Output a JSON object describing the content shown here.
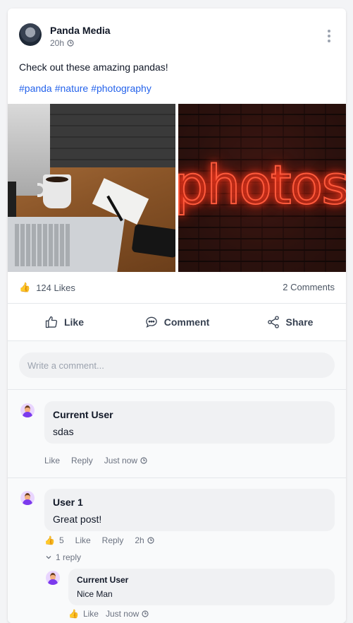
{
  "post": {
    "author": "Panda Media",
    "time": "20h",
    "text": "Check out these amazing pandas!",
    "hashtags": [
      "#panda",
      "#nature",
      "#photography"
    ],
    "photo_neon_text": "photos",
    "likes_emoji": "👍",
    "likes": "124 Likes",
    "comments_count": "2 Comments"
  },
  "actions": {
    "like": "Like",
    "comment": "Comment",
    "share": "Share"
  },
  "comment_input": {
    "placeholder": "Write a comment..."
  },
  "comments": [
    {
      "name": "Current User",
      "text": "sdas",
      "like": "Like",
      "reply": "Reply",
      "time": "Just now"
    },
    {
      "name": "User 1",
      "text": "Great post!",
      "reaction_emoji": "👍",
      "reaction_count": "5",
      "like": "Like",
      "reply": "Reply",
      "time": "2h",
      "replies_toggle": "1 reply",
      "reply_item": {
        "name": "Current User",
        "text": "Nice Man",
        "reaction_emoji": "👍",
        "like": "Like",
        "time": "Just now"
      }
    }
  ]
}
